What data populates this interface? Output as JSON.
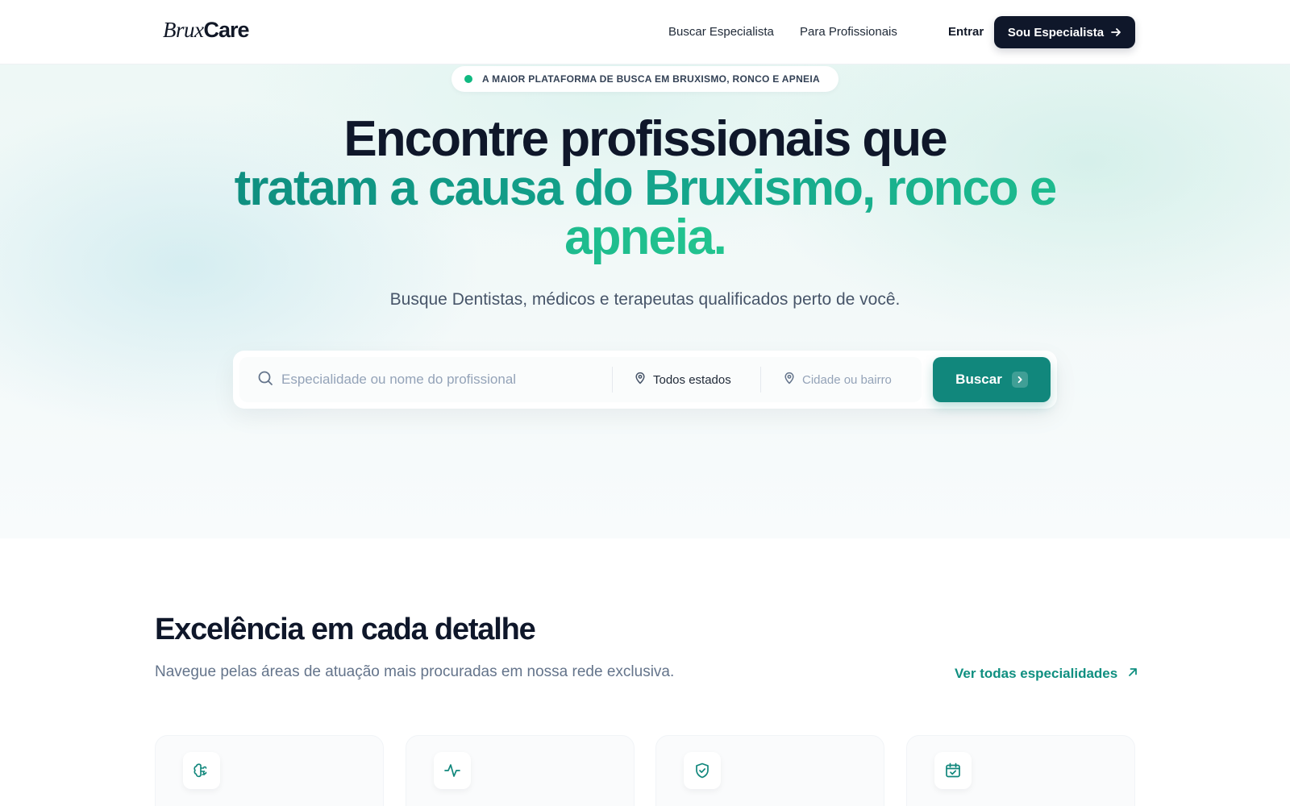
{
  "header": {
    "logo_part1": "Brux",
    "logo_part2": "Care",
    "nav": {
      "buscar": "Buscar Especialista",
      "profissionais": "Para Profissionais"
    },
    "login": "Entrar",
    "cta": "Sou Especialista"
  },
  "hero": {
    "badge": "A MAIOR PLATAFORMA DE BUSCA EM BRUXISMO, RONCO E APNEIA",
    "title_line1": "Encontre profissionais que",
    "title_accent": "tratam a causa do Bruxismo, ronco e apneia.",
    "subtitle": "Busque Dentistas, médicos e terapeutas qualificados perto de você.",
    "search": {
      "query_placeholder": "Especialidade ou nome do profissional",
      "state_value": "Todos estados",
      "city_placeholder": "Cidade ou bairro",
      "button": "Buscar"
    }
  },
  "section": {
    "title": "Excelência em cada detalhe",
    "subtitle": "Navegue pelas áreas de atuação mais procuradas em nossa rede exclusiva.",
    "link": "Ver todas especialidades"
  },
  "cards": [
    {
      "icon": "brain-icon"
    },
    {
      "icon": "activity-icon"
    },
    {
      "icon": "shield-check-icon"
    },
    {
      "icon": "calendar-check-icon"
    }
  ],
  "colors": {
    "brand_dark": "#0f172a",
    "brand_teal": "#11877c",
    "accent_green": "#10b981"
  }
}
